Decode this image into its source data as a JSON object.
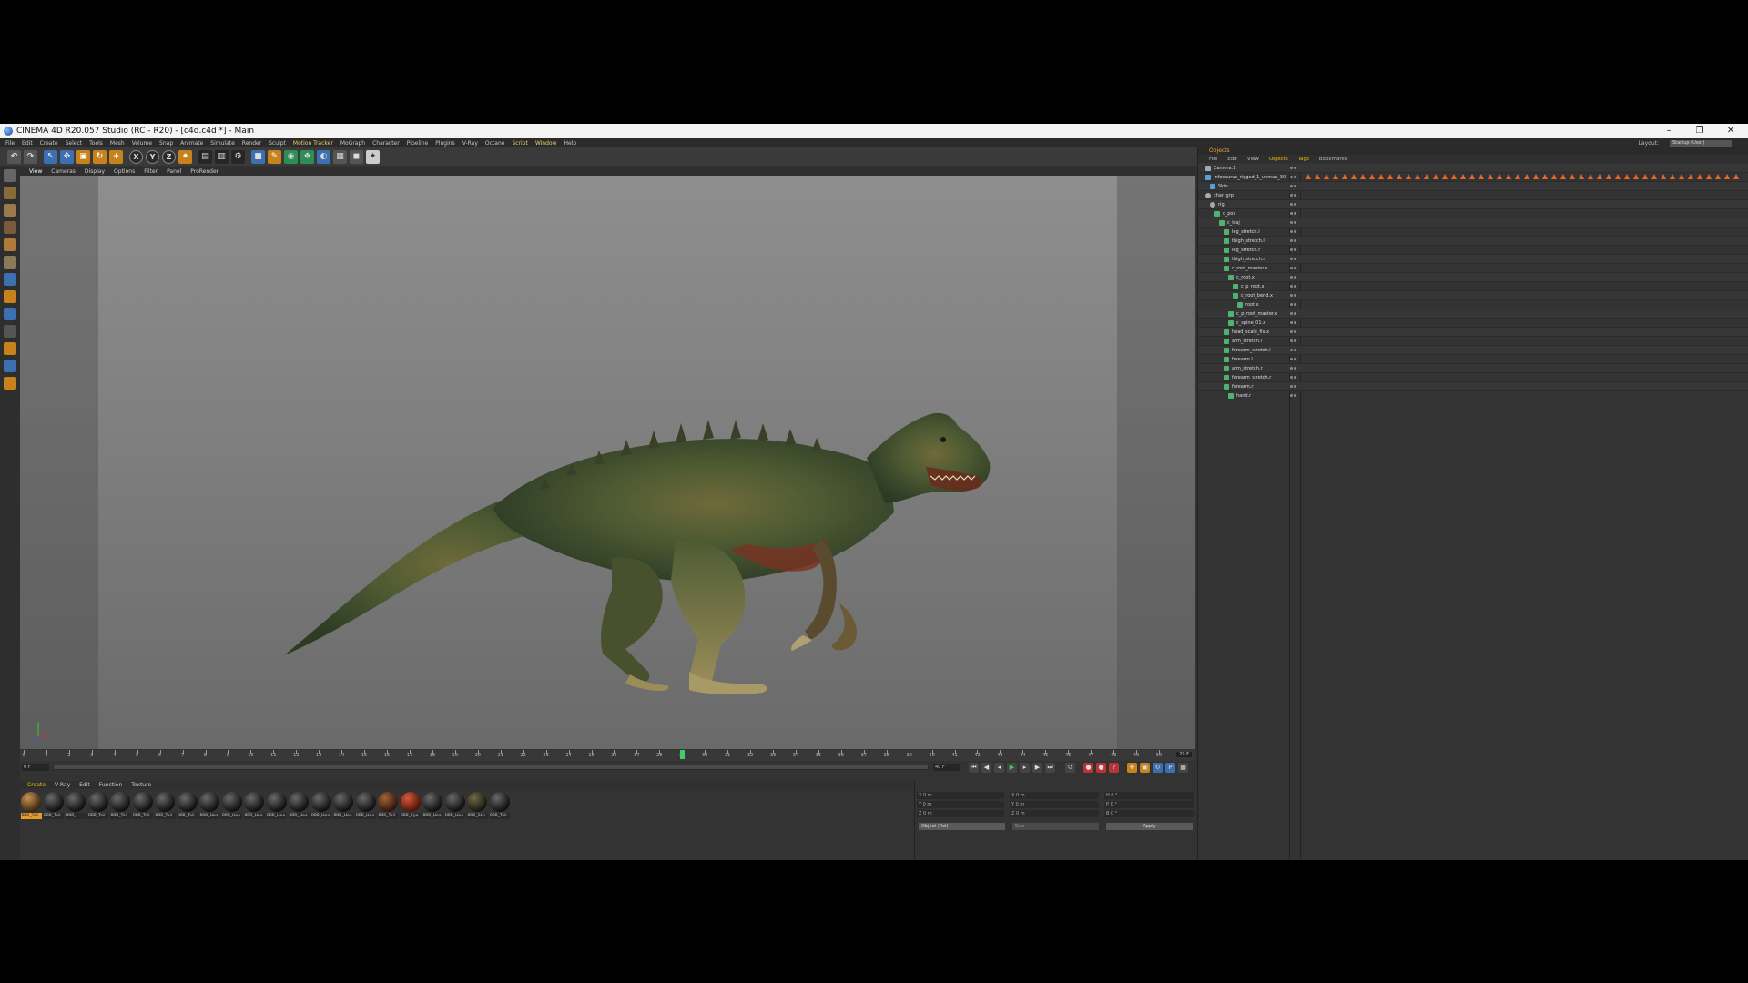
{
  "window": {
    "title": "CINEMA 4D R20.057 Studio (RC - R20) - [c4d.c4d *] - Main",
    "controls": [
      "–",
      "❐",
      "✕"
    ]
  },
  "menubar": {
    "items": [
      "File",
      "Edit",
      "Create",
      "Select",
      "Tools",
      "Mesh",
      "Volume",
      "Snap",
      "Animate",
      "Simulate",
      "Render",
      "Sculpt",
      "Motion Tracker",
      "MoGraph",
      "Character",
      "Pipeline",
      "Plugins",
      "V-Ray",
      "Octane",
      "Script",
      "Window",
      "Help"
    ],
    "highlighted": [
      "Motion Tracker",
      "Script",
      "Window"
    ],
    "layout_label": "Layout:",
    "layout_value": "Startup (User)"
  },
  "toolbar": {
    "icons": [
      "undo-icon",
      "redo-icon",
      "live-select-icon",
      "move-icon",
      "scale-icon",
      "rotate-icon",
      "add-icon",
      "x-axis-icon",
      "y-axis-icon",
      "z-axis-icon",
      "coordinate-system-icon",
      "render-view-icon",
      "render-to-picture-viewer-icon",
      "render-settings-icon",
      "cube-icon",
      "pen-icon",
      "subdivision-icon",
      "array-icon",
      "deformer-icon",
      "scene-icon",
      "camera-icon",
      "light-icon"
    ],
    "axis_labels": [
      "X",
      "Y",
      "Z"
    ]
  },
  "viewport": {
    "menu": [
      "View",
      "Cameras",
      "Display",
      "Options",
      "Filter",
      "Panel",
      "ProRender"
    ]
  },
  "timeline": {
    "ticks": [
      "0",
      "1",
      "2",
      "3",
      "4",
      "5",
      "6",
      "7",
      "8",
      "9",
      "10",
      "11",
      "12",
      "13",
      "14",
      "15",
      "16",
      "17",
      "18",
      "19",
      "20",
      "21",
      "22",
      "23",
      "24",
      "25",
      "26",
      "27",
      "28",
      "29",
      "30",
      "31",
      "32",
      "33",
      "34",
      "35",
      "36",
      "37",
      "38",
      "39",
      "40",
      "41",
      "42",
      "43",
      "44",
      "45",
      "46",
      "47",
      "48",
      "49",
      "50"
    ],
    "current_frame": 29,
    "end_label": "29 F",
    "start_field": "0 F",
    "end_field": "40 F",
    "range_start": "0 F",
    "range_end": "40 F"
  },
  "material_manager": {
    "menu": [
      "Create",
      "V-Ray",
      "Edit",
      "Function",
      "Texture"
    ],
    "materials": [
      {
        "label": "PBR_Tail",
        "style": "brown",
        "selected": true
      },
      {
        "label": "PBR_Tail",
        "style": "dark"
      },
      {
        "label": "PBR_",
        "style": "dark"
      },
      {
        "label": "PBR_Tail",
        "style": "dark"
      },
      {
        "label": "PBR_Tail",
        "style": "dark"
      },
      {
        "label": "PBR_Tail",
        "style": "dark"
      },
      {
        "label": "PBR_Tail",
        "style": "dark"
      },
      {
        "label": "PBR_Tail",
        "style": "dark"
      },
      {
        "label": "PBR_Hea",
        "style": "dark"
      },
      {
        "label": "PBR_Hea",
        "style": "dark"
      },
      {
        "label": "PBR_Hea",
        "style": "dark"
      },
      {
        "label": "PBR_Hea",
        "style": "dark"
      },
      {
        "label": "PBR_Hea",
        "style": "dark"
      },
      {
        "label": "PBR_Hea",
        "style": "dark"
      },
      {
        "label": "PBR_Hea",
        "style": "dark"
      },
      {
        "label": "PBR_Hea",
        "style": "dark"
      },
      {
        "label": "PBR_Tail",
        "style": "rust"
      },
      {
        "label": "PBR_Eye",
        "style": "red"
      },
      {
        "label": "PBR_Hea",
        "style": "dark"
      },
      {
        "label": "PBR_Hea",
        "style": "dark"
      },
      {
        "label": "PBR_Skn",
        "style": "olive"
      },
      {
        "label": "PBR_Tail",
        "style": "dark"
      }
    ]
  },
  "coordinates": {
    "rows": [
      {
        "a": "X",
        "av": "0 m",
        "b": "X",
        "bv": "0 m",
        "c": "H",
        "cv": "0 °"
      },
      {
        "a": "Y",
        "av": "0 m",
        "b": "Y",
        "bv": "0 m",
        "c": "P",
        "cv": "0 °"
      },
      {
        "a": "Z",
        "av": "0 m",
        "b": "Z",
        "bv": "0 m",
        "c": "B",
        "cv": "0 °"
      }
    ],
    "mode": "Object (Rel)",
    "size_mode": "Size",
    "apply": "Apply"
  },
  "object_manager": {
    "title": "Objects",
    "menu": [
      "File",
      "Edit",
      "View",
      "Objects",
      "Tags",
      "Bookmarks"
    ],
    "objects": [
      {
        "name": "Camera.1",
        "indent": 0,
        "icon": "cam"
      },
      {
        "name": "Infosaurus_rigged_1_unmap_30",
        "indent": 0,
        "icon": "poly"
      },
      {
        "name": "Skin",
        "indent": 1,
        "icon": "poly"
      },
      {
        "name": "char_grp",
        "indent": 0,
        "icon": "null"
      },
      {
        "name": "rig",
        "indent": 1,
        "icon": "null"
      },
      {
        "name": "c_pos",
        "indent": 2,
        "icon": "joint"
      },
      {
        "name": "c_traj",
        "indent": 3,
        "icon": "joint"
      },
      {
        "name": "leg_stretch.l",
        "indent": 4,
        "icon": "joint"
      },
      {
        "name": "thigh_stretch.l",
        "indent": 4,
        "icon": "joint"
      },
      {
        "name": "leg_stretch.r",
        "indent": 4,
        "icon": "joint"
      },
      {
        "name": "thigh_stretch.r",
        "indent": 4,
        "icon": "joint"
      },
      {
        "name": "c_root_master.x",
        "indent": 4,
        "icon": "joint"
      },
      {
        "name": "c_root.x",
        "indent": 5,
        "icon": "joint"
      },
      {
        "name": "c_p_root.x",
        "indent": 6,
        "icon": "joint"
      },
      {
        "name": "c_root_bend.x",
        "indent": 6,
        "icon": "joint"
      },
      {
        "name": "root.x",
        "indent": 7,
        "icon": "joint"
      },
      {
        "name": "c_p_root_master.x",
        "indent": 5,
        "icon": "joint"
      },
      {
        "name": "c_spine_01.x",
        "indent": 5,
        "icon": "joint"
      },
      {
        "name": "head_scale_fix.x",
        "indent": 4,
        "icon": "joint"
      },
      {
        "name": "arm_stretch.l",
        "indent": 4,
        "icon": "joint"
      },
      {
        "name": "forearm_stretch.l",
        "indent": 4,
        "icon": "joint"
      },
      {
        "name": "forearm.l",
        "indent": 4,
        "icon": "joint"
      },
      {
        "name": "arm_stretch.r",
        "indent": 4,
        "icon": "joint"
      },
      {
        "name": "forearm_stretch.r",
        "indent": 4,
        "icon": "joint"
      },
      {
        "name": "forearm.r",
        "indent": 4,
        "icon": "joint"
      },
      {
        "name": "hand.r",
        "indent": 5,
        "icon": "joint"
      }
    ],
    "keyframe_count": 48
  },
  "colors": {
    "accent": "#e8a53c",
    "playhead": "#3ccf6a",
    "keyframe": "#e0662a",
    "panel_bg": "#333333"
  }
}
